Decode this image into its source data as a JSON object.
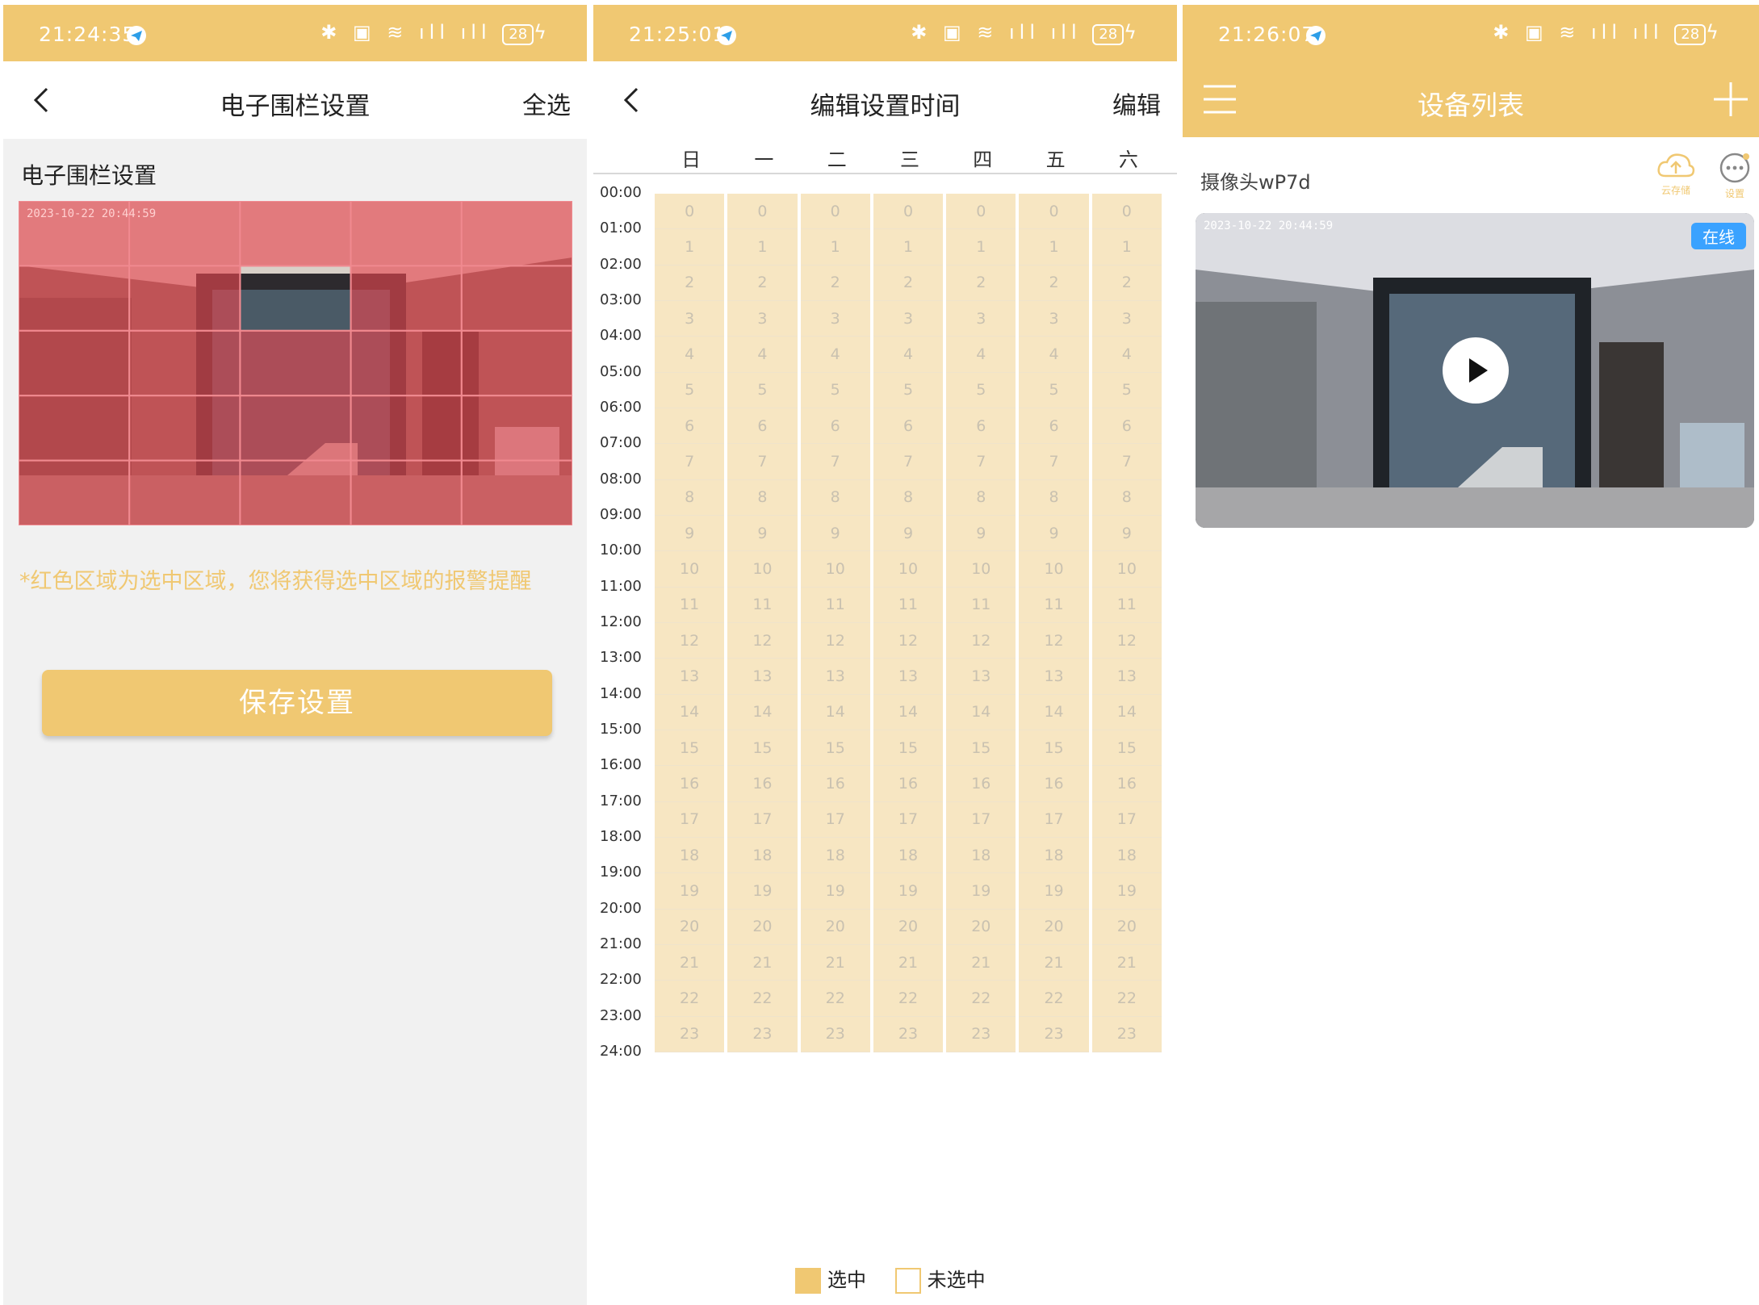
{
  "colors": {
    "accent": "#f0c872",
    "fence_red": "#e8454f",
    "online_badge": "#3aa2ff"
  },
  "screen1": {
    "status": {
      "time": "21:24:35",
      "battery": "28"
    },
    "nav": {
      "title": "电子围栏设置",
      "right": "全选"
    },
    "section_title": "电子围栏设置",
    "timestamp": "2023-10-22 20:44:59",
    "hint": "*红色区域为选中区域，您将获得选中区域的报警提醒",
    "save_label": "保存设置",
    "grid": {
      "cols": 5,
      "rows": 5,
      "unselected": [
        [
          1,
          2
        ]
      ]
    }
  },
  "screen2": {
    "status": {
      "time": "21:25:01",
      "battery": "28"
    },
    "nav": {
      "title": "编辑设置时间",
      "right": "编辑"
    },
    "days": [
      "日",
      "一",
      "二",
      "三",
      "四",
      "五",
      "六"
    ],
    "times": [
      "00:00",
      "01:00",
      "02:00",
      "03:00",
      "04:00",
      "05:00",
      "06:00",
      "07:00",
      "08:00",
      "09:00",
      "10:00",
      "11:00",
      "12:00",
      "13:00",
      "14:00",
      "15:00",
      "16:00",
      "17:00",
      "18:00",
      "19:00",
      "20:00",
      "21:00",
      "22:00",
      "23:00",
      "24:00"
    ],
    "hours": [
      "0",
      "1",
      "2",
      "3",
      "4",
      "5",
      "6",
      "7",
      "8",
      "9",
      "10",
      "11",
      "12",
      "13",
      "14",
      "15",
      "16",
      "17",
      "18",
      "19",
      "20",
      "21",
      "22",
      "23"
    ],
    "legend": {
      "selected": "选中",
      "unselected": "未选中"
    }
  },
  "screen3": {
    "status": {
      "time": "21:26:07",
      "battery": "28"
    },
    "title": "设备列表",
    "device_name": "摄像头wP7d",
    "cloud_label": "云存储",
    "settings_label": "设置",
    "timestamp": "2023-10-22 20:44:59",
    "online_label": "在线"
  }
}
